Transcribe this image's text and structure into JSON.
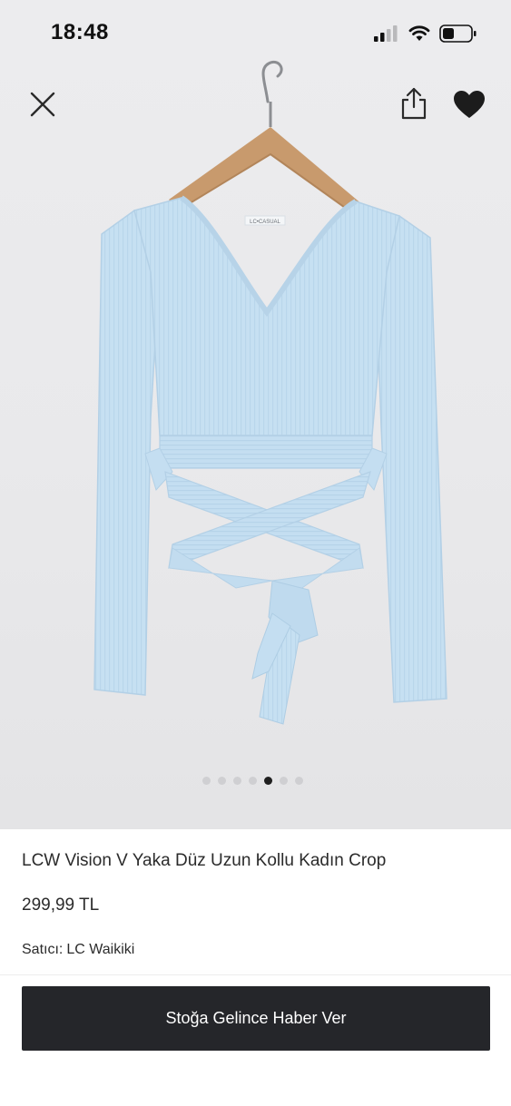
{
  "status_bar": {
    "time": "18:48"
  },
  "product": {
    "title": "LCW Vision V Yaka Düz Uzun Kollu Kadın Crop",
    "price": "299,99 TL",
    "seller_label": "Satıcı:",
    "seller_name": "LC Waikiki",
    "tag_text": "LC•CASUAL"
  },
  "gallery": {
    "total_images": 7,
    "active_index": 4
  },
  "actions": {
    "notify_label": "Stoğa Gelince Haber Ver"
  },
  "icons": [
    "close-icon",
    "share-icon",
    "heart-icon",
    "signal-icon",
    "wifi-icon",
    "battery-icon"
  ],
  "colors": {
    "product": "#c9e2f3",
    "cta_background": "#25262a",
    "active_dot": "#1f1f1f",
    "inactive_dot": "#cfcfd2"
  }
}
